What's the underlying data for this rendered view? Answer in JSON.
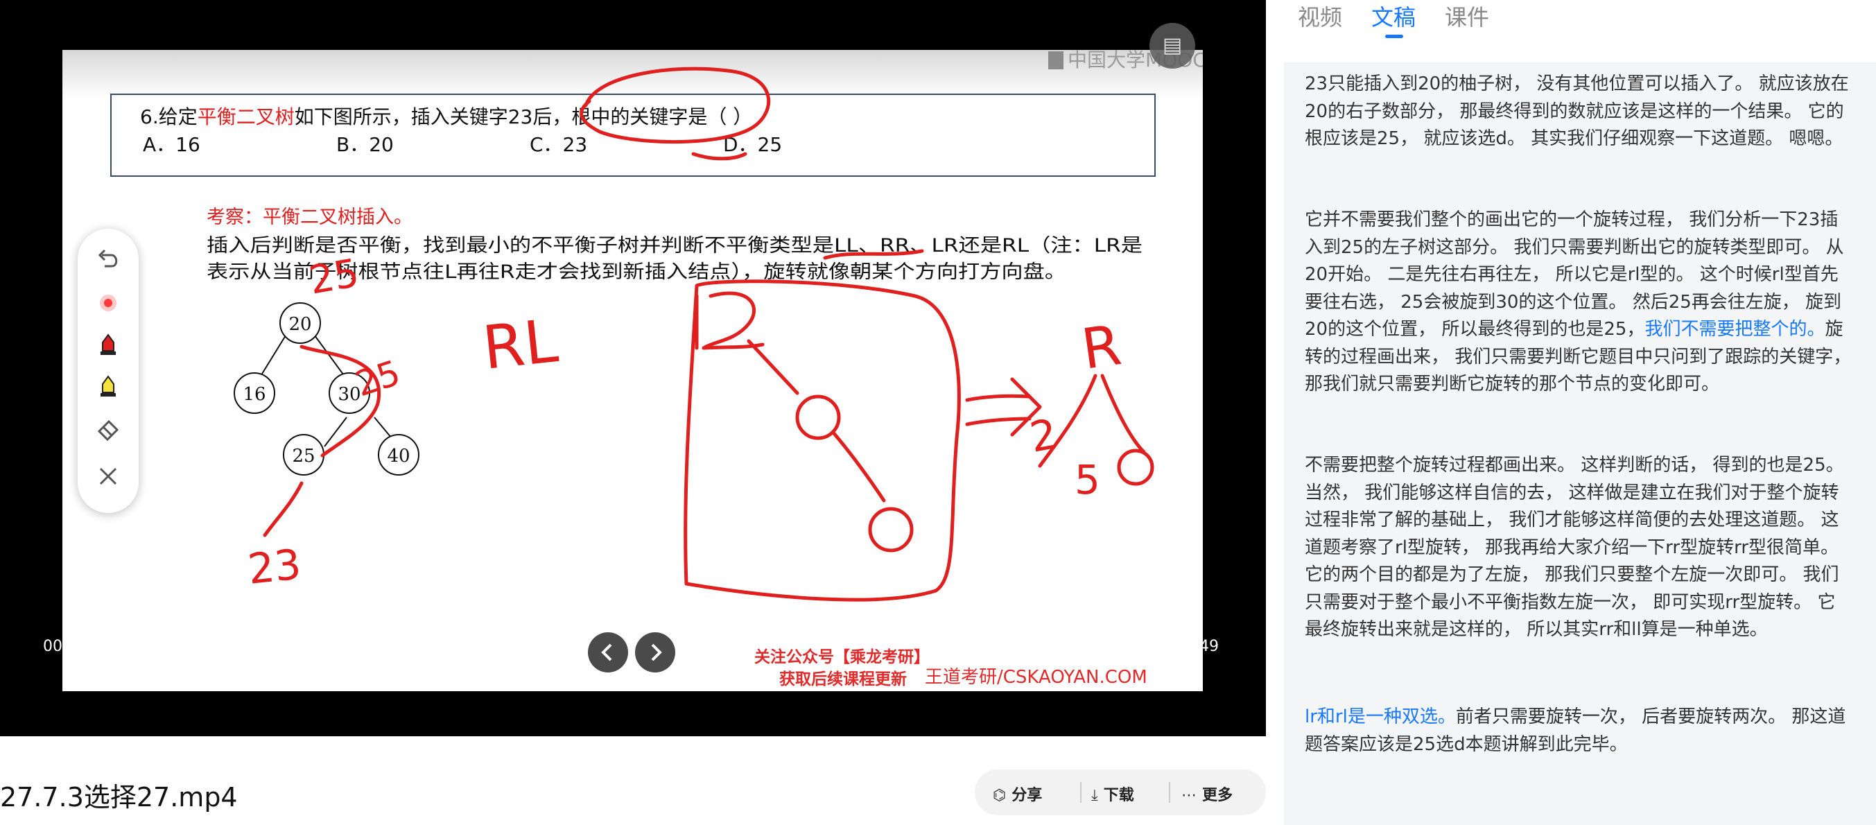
{
  "video": {
    "title": "27.7.3选择27.mp4",
    "time_current": "00",
    "time_total": "49",
    "doc_toggle_icon": "document-icon"
  },
  "slide": {
    "question_prefix": "6.给定",
    "question_keyword": "平衡二叉树",
    "question_rest": "如下图所示，插入关键字23后，根中的关键字是（   ）",
    "option_a": "A．16",
    "option_b": "B．20",
    "option_c": "C．23",
    "option_d": "D．25",
    "exam_point": "考察：平衡二叉树插入。",
    "explanation_line1": "插入后判断是否平衡，找到最小的不平衡子树并判断不平衡类型是LL、RR、LR还是RL（注：LR是",
    "explanation_line2": "表示从当前子树根节点往L再往R走才会找到新插入结点），旋转就像朝某个方向打方向盘。",
    "tree_nodes": [
      "20",
      "16",
      "30",
      "25",
      "40"
    ],
    "watermark": "中国大学MOOC",
    "ad_line1": "关注公众号【乘龙考研】",
    "ad_line2": "获取后续课程更新",
    "brand": "王道考研/CSKAOYAN.COM",
    "handwriting": [
      "25",
      "25",
      "23",
      "RL",
      "R",
      "2",
      "5"
    ]
  },
  "toolbar": {
    "tools": [
      "undo-icon",
      "laser-pointer-icon",
      "pen-icon",
      "highlighter-icon",
      "eraser-icon",
      "close-icon"
    ]
  },
  "actions": {
    "share": "分享",
    "download": "下载",
    "more": "更多"
  },
  "tabs": {
    "video": "视频",
    "transcript": "文稿",
    "courseware": "课件",
    "active": "文稿"
  },
  "transcript": {
    "p1": "23只能插入到20的柚子树， 没有其他位置可以插入了。 就应该放在20的右子数部分， 那最终得到的数就应该是这样的一个结果。 它的根应该是25， 就应该选d。 其实我们仔细观察一下这道题。 嗯嗯。",
    "p2a": "它并不需要我们整个的画出它的一个旋转过程， 我们分析一下23插入到25的左子树这部分。 我们只需要判断出它的旋转类型即可。 从20开始。 二是先往右再往左， 所以它是rl型的。 这个时候rl型首先要往右选， 25会被旋到30的这个位置。 然后25再会往左旋， 旋到20的这个位置， 所以最终得到的也是25，",
    "p2_hl": "我们不需要把整个的。",
    "p2b": "旋转的过程画出来， 我们只需要判断它题目中只问到了跟踪的关键字， 那我们就只需要判断它旋转的那个节点的变化即可。",
    "p3": "不需要把整个旋转过程都画出来。 这样判断的话， 得到的也是25。 当然， 我们能够这样自信的去， 这样做是建立在我们对于整个旋转过程非常了解的基础上， 我们才能够这样简便的去处理这道题。 这道题考察了rl型旋转， 那我再给大家介绍一下rr型旋转rr型很简单。 它的两个目的都是为了左旋， 那我们只要整个左旋一次即可。 我们只需要对于整个最小不平衡指数左旋一次， 即可实现rr型旋转。 它最终旋转出来就是这样的， 所以其实rr和ll算是一种单选。",
    "p4_hl": "lr和rl是一种双选。",
    "p4b": "前者只需要旋转一次， 后者要旋转两次。 那这道题答案应该是25选d本题讲解到此完毕。"
  },
  "colors": {
    "accent": "#1677ff",
    "ink_red": "#e01f1f",
    "player_bg": "#000000"
  }
}
